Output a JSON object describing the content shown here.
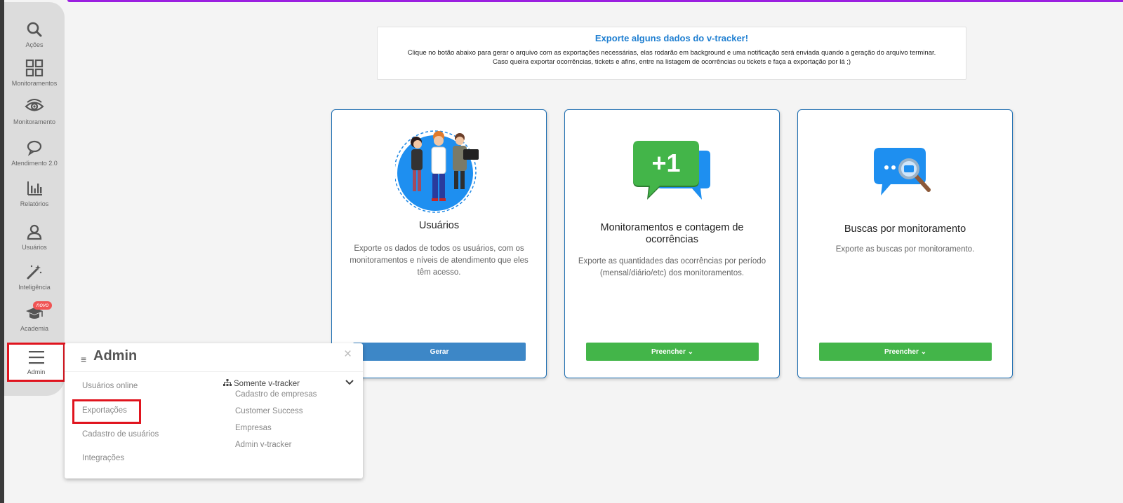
{
  "sidebar": {
    "items": [
      {
        "label": "Ações",
        "icon": "search-icon"
      },
      {
        "label": "Monitoramentos",
        "icon": "grid-icon"
      },
      {
        "label": "Monitoramento",
        "icon": "eye-icon"
      },
      {
        "label": "Atendimento 2.0",
        "icon": "chat-bubble-icon"
      },
      {
        "label": "Relatórios",
        "icon": "bar-chart-icon"
      },
      {
        "label": "Usuários",
        "icon": "user-icon"
      },
      {
        "label": "Inteligência",
        "icon": "magic-wand-icon"
      },
      {
        "label": "Academia",
        "icon": "graduation-cap-icon",
        "badge": "novo"
      }
    ],
    "admin": {
      "label": "Admin",
      "icon": "hamburger-menu-icon"
    }
  },
  "banner": {
    "title": "Exporte alguns dados do v-tracker!",
    "line1": "Clique no botão abaixo para gerar o arquivo com as exportações necessárias, elas rodarão em background e uma notificação será enviada quando a geração do arquivo terminar.",
    "line2": "Caso queira exportar ocorrências, tickets e afins, entre na listagem de ocorrências ou tickets e faça a exportação por lá ;)"
  },
  "cards": [
    {
      "title": "Usuários",
      "description": "Exporte os dados de todos os usuários, com os monitoramentos e níveis de atendimento que eles têm acesso.",
      "button": "Gerar"
    },
    {
      "title": "Monitoramentos e contagem de ocorrências",
      "description": "Exporte as quantidades das ocorrências por período (mensal/diário/etc) dos monitoramentos.",
      "button": "Preencher",
      "art_text": "+1"
    },
    {
      "title": "Buscas por monitoramento",
      "description": "Exporte as buscas por monitoramento.",
      "button": "Preencher"
    }
  ],
  "admin_panel": {
    "title": "Admin",
    "close": "×",
    "links": [
      "Usuários online",
      "Exportações",
      "Cadastro de usuários",
      "Integrações"
    ],
    "group": {
      "title": "Somente v-tracker",
      "items": [
        "Cadastro de empresas",
        "Customer Success",
        "Empresas",
        "Admin v-tracker"
      ]
    }
  },
  "colors": {
    "accent_top": "#9b1fe0",
    "banner_title": "#1f7fd1",
    "button_blue": "#3d87c7",
    "button_green": "#43b549",
    "highlight_red": "#e0141e",
    "badge_red": "#f05454"
  }
}
